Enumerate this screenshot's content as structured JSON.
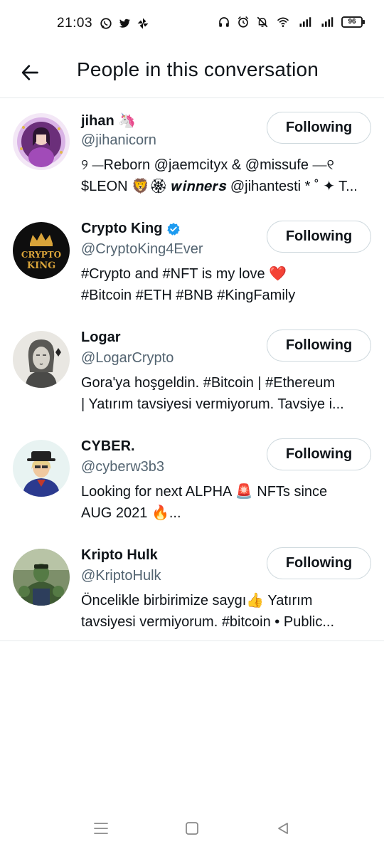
{
  "status_bar": {
    "time": "21:03",
    "left_icons": [
      "whatsapp-icon",
      "twitter-icon",
      "pinwheel-icon"
    ],
    "right_icons": [
      "headphones-icon",
      "alarm-icon",
      "mute-icon",
      "wifi-icon",
      "signal-icon",
      "signal-icon"
    ],
    "battery": "96"
  },
  "header": {
    "back_icon": "back-arrow-icon",
    "title": "People in this conversation"
  },
  "colors": {
    "text_primary": "#0f1419",
    "text_secondary": "#536471",
    "divider": "#e6e9ec",
    "button_border": "#cfd9de",
    "verified": "#1d9bf0",
    "heart": "#e0245e"
  },
  "people": [
    {
      "name": "jihan 🦄",
      "verified": false,
      "handle": "@jihanicorn",
      "bio_line1": "୨ ⎯⎯Reborn @jaemcityx & @missufe ⎯⎯୧",
      "bio_line2": "$LEON 🦁🏵 𝒘𝒊𝒏𝒏𝒆𝒓𝒔 @jihantesti * ˚ ✦ T...",
      "follow_label": "Following"
    },
    {
      "name": "Crypto King",
      "verified": true,
      "handle": "@CryptoKing4Ever",
      "bio_line1": "#Crypto and #NFT is my love ❤️",
      "bio_line2": "#Bitcoin #ETH #BNB #KingFamily",
      "follow_label": "Following",
      "avatar_text_1": "CRYPTO",
      "avatar_text_2": "KING"
    },
    {
      "name": "Logar",
      "verified": false,
      "handle": "@LogarCrypto",
      "bio_line1": "Gora'ya hoşgeldin. #Bitcoin | #Ethereum",
      "bio_line2": "| Yatırım tavsiyesi vermiyorum. Tavsiye i...",
      "follow_label": "Following"
    },
    {
      "name": "CYBER.",
      "verified": false,
      "handle": "@cyberw3b3",
      "bio_line1": "Looking for next ALPHA 🚨 NFTs since",
      "bio_line2": "AUG 2021 🔥...",
      "follow_label": "Following"
    },
    {
      "name": "Kripto Hulk",
      "verified": false,
      "handle": "@KriptoHulk",
      "bio_line1": "Öncelikle birbirimize saygı👍 Yatırım",
      "bio_line2": "tavsiyesi vermiyorum. #bitcoin • Public...",
      "follow_label": "Following"
    }
  ],
  "nav_bar": {
    "icons": [
      "menu-icon",
      "home-square-icon",
      "back-triangle-icon"
    ]
  }
}
